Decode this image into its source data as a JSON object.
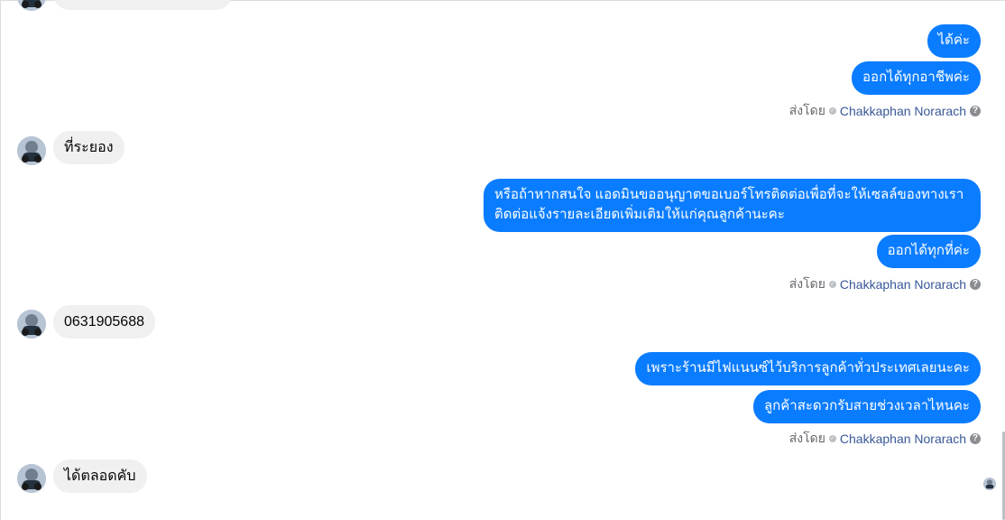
{
  "conversation": {
    "sender_name": "Chakkaphan Norarach",
    "sent_by_label": "ส่งโดย",
    "top_partial_bubble": "",
    "groups": [
      {
        "outgoing": [
          "ได้ค่ะ",
          "ออกได้ทุกอาชีพค่ะ"
        ]
      },
      {
        "incoming": "ที่ระยอง"
      },
      {
        "outgoing": [
          "หรือถ้าหากสนใจ แอดมินขออนุญาตขอเบอร์โทรติดต่อเพื่อที่จะให้เซลล์ของทางเรา ติดต่อแจ้งรายละเอียดเพิ่มเติมให้แก่คุณลูกค้านะคะ",
          "ออกได้ทุกที่ค่ะ"
        ]
      },
      {
        "incoming": "0631905688"
      },
      {
        "outgoing": [
          "เพราะร้านมีไฟแนนซ์ไว้บริการลูกค้าทั่วประเทศเลยนะคะ",
          "ลูกค้าสะดวกรับสายช่วงเวลาไหนคะ"
        ]
      },
      {
        "incoming": "ได้ตลอดคับ"
      }
    ]
  },
  "icons": {
    "check": "check-circle-icon",
    "help": "question-circle-icon"
  },
  "colors": {
    "outgoing_bubble": "#0a7cff",
    "incoming_bubble": "#f0f0f0",
    "sender_link": "#385898",
    "meta_text": "#65676b"
  }
}
